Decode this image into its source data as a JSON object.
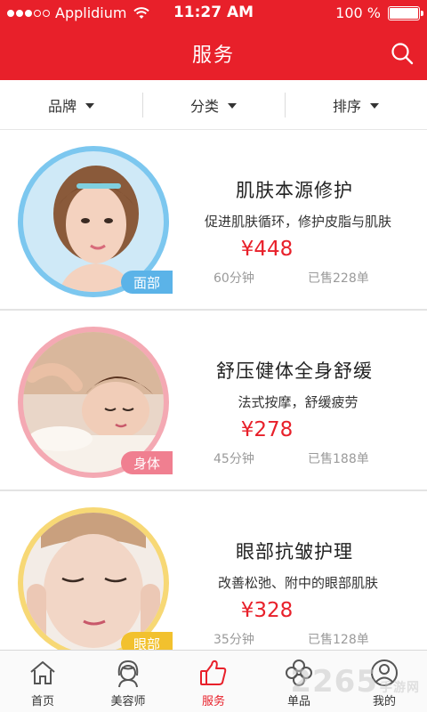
{
  "status_bar": {
    "carrier": "Applidium",
    "time": "11:27 AM",
    "battery": "100 %",
    "battery_level": 1.0,
    "signal_bars_filled": 3,
    "signal_bars_total": 5
  },
  "nav": {
    "title": "服务",
    "search_icon": "search-icon"
  },
  "filters": [
    {
      "label": "品牌",
      "icon": "caret-down-icon"
    },
    {
      "label": "分类",
      "icon": "caret-down-icon"
    },
    {
      "label": "排序",
      "icon": "caret-down-icon"
    }
  ],
  "services": [
    {
      "name": "肌肤本源修护",
      "description": "促进肌肤循环，修护皮脂与肌肤",
      "price": "¥448",
      "duration": "60分钟",
      "sold": "已售228单",
      "tag": "面部",
      "ring_color": "#7cc7ef",
      "tag_color": "#5bb3e8"
    },
    {
      "name": "舒压健体全身舒缓",
      "description": "法式按摩，舒缓疲劳",
      "price": "¥278",
      "duration": "45分钟",
      "sold": "已售188单",
      "tag": "身体",
      "ring_color": "#f4a9b3",
      "tag_color": "#f07f90"
    },
    {
      "name": "眼部抗皱护理",
      "description": "改善松弛、附中的眼部肌肤",
      "price": "¥328",
      "duration": "35分钟",
      "sold": "已售128单",
      "tag": "眼部",
      "ring_color": "#f7d875",
      "tag_color": "#f2c12e"
    }
  ],
  "tabs": [
    {
      "label": "首页",
      "icon": "home-icon",
      "active": false
    },
    {
      "label": "美容师",
      "icon": "beautician-icon",
      "active": false
    },
    {
      "label": "服务",
      "icon": "thumbs-up-icon",
      "active": true
    },
    {
      "label": "单品",
      "icon": "flower-icon",
      "active": false
    },
    {
      "label": "我的",
      "icon": "user-icon",
      "active": false
    }
  ],
  "watermark": {
    "text": "2265",
    "suffix": "手游网"
  },
  "colors": {
    "brand_red": "#e8202a",
    "price_red": "#e8202a",
    "muted_gray": "#9a9a9a"
  }
}
